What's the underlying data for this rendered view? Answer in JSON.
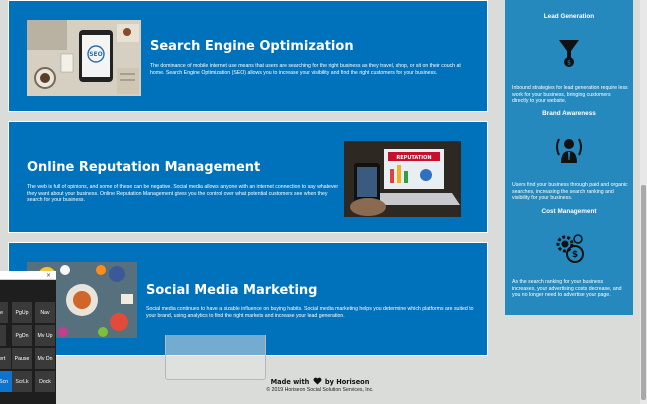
{
  "cards": {
    "seo": {
      "title": "Search Engine Optimization",
      "body": "The dominance of mobile internet use means that users are searching for the right business as they travel, shop, or sit on their couch at home. Search Engine Optimization (SEO) allows you to increase your visibility and find the right customers for your business.",
      "image_text": "SEO"
    },
    "orm": {
      "title": "Online Reputation Management",
      "body": "The web is full of opinions, and some of these can be negative. Social media allows anyone with an internet connection to say whatever they want about your business. Online Reputation Management gives you the control over what potential customers see when they search for your business.",
      "image_text": "REPUTATION"
    },
    "smm": {
      "title": "Social Media Marketing",
      "body": "Social media continues to have a sizable influence on buying habits. Social media marketing helps you determine which platforms are suited to your brand, using analytics to find the right markets and increase your lead generation."
    }
  },
  "sidebar": {
    "items": [
      {
        "title": "Lead Generation",
        "icon": "funnel-icon",
        "body": "Inbound strategies for lead generation require less work for your business, bringing customers directly to your website."
      },
      {
        "title": "Brand Awareness",
        "icon": "person-broadcast-icon",
        "body": "Users find your business through paid and organic searches, increasing the search ranking and visibility for your business."
      },
      {
        "title": "Cost Management",
        "icon": "money-gears-icon",
        "body": "As the search ranking for your business increases, your advertising costs decrease, and you no longer need to advertise your page."
      }
    ]
  },
  "footer": {
    "made_prefix": "Made with",
    "made_suffix": "by Horiseon",
    "copyright": "© 2019 Horiseon Social Solution Services, Inc."
  },
  "onscreen_keyboard": {
    "close_glyph": "×",
    "rows": [
      [
        "ome",
        "PgUp",
        "Nav"
      ],
      [
        "d",
        "PgDn",
        "Mv Up"
      ],
      [
        "sert",
        "Pause",
        "Mv Dn"
      ],
      [
        "rtScn",
        "ScrLk",
        "Dock"
      ]
    ]
  },
  "colors": {
    "card_blue": "#0072bb",
    "sidebar_blue": "#2589bd",
    "page_background": "#d9dcd8",
    "keyboard_active": "#0c74cf"
  }
}
